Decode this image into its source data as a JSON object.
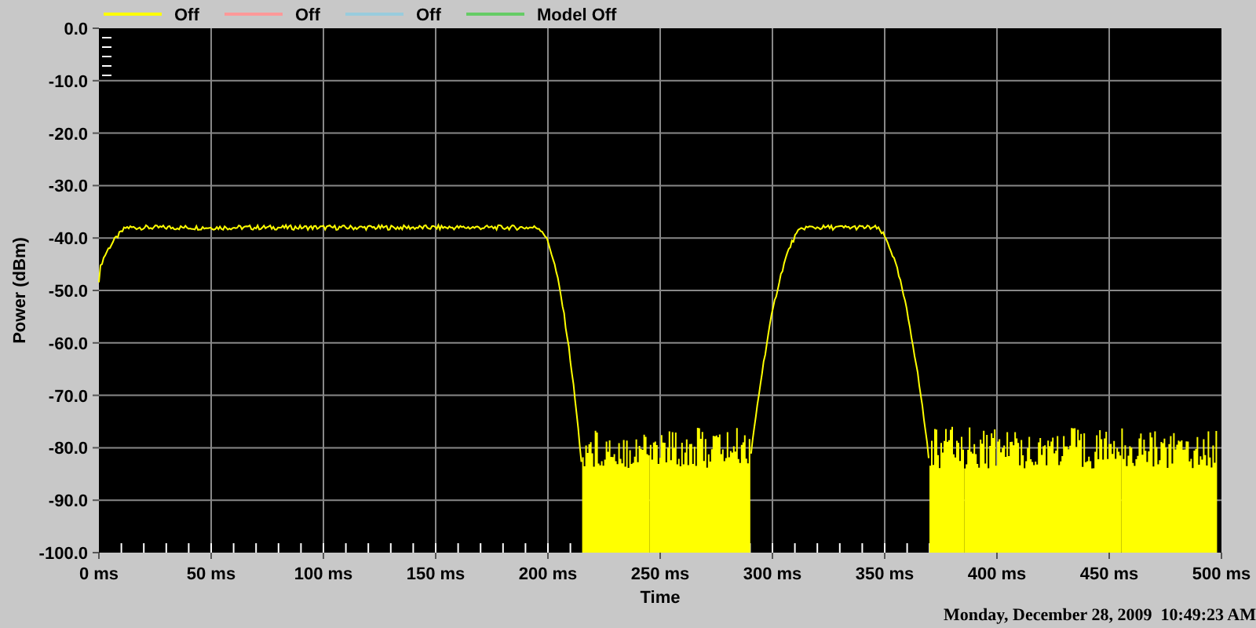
{
  "legend": [
    {
      "label": "Off",
      "color": "#ffff00"
    },
    {
      "label": "Off",
      "color": "#ff9999"
    },
    {
      "label": "Off",
      "color": "#99ccdd"
    },
    {
      "label": "Model Off",
      "color": "#66cc66"
    }
  ],
  "chart": {
    "ylabel": "Power (dBm)",
    "xlabel": "Time",
    "yticks": [
      "0.0",
      "-10.0",
      "-20.0",
      "-30.0",
      "-40.0",
      "-50.0",
      "-60.0",
      "-70.0",
      "-80.0",
      "-90.0",
      "-100.0"
    ],
    "xticks": [
      "0 ms",
      "50 ms",
      "100 ms",
      "150 ms",
      "200 ms",
      "250 ms",
      "300 ms",
      "350 ms",
      "400 ms",
      "450 ms",
      "500 ms"
    ]
  },
  "timestamp": "Monday, December 28, 2009  10:49:23 AM"
}
